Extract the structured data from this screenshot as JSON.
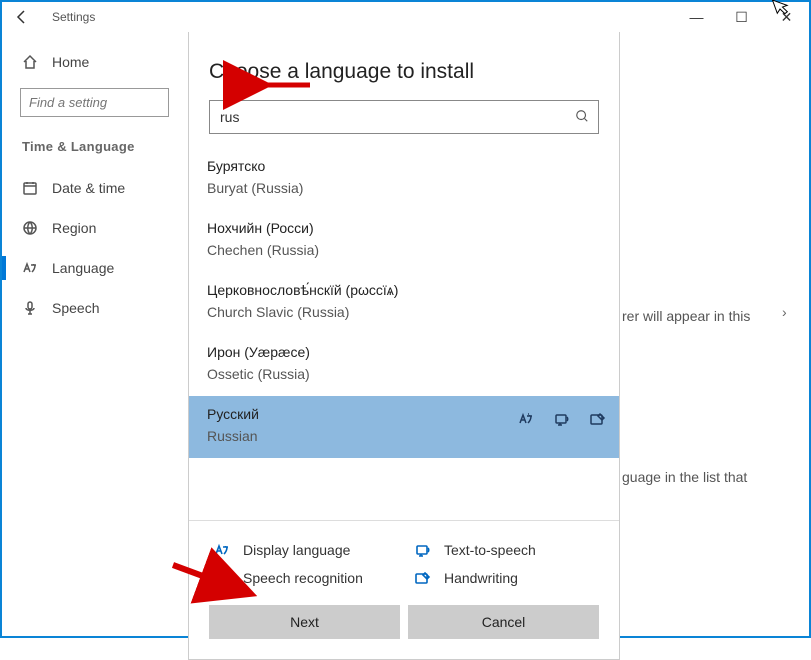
{
  "app": {
    "title": "Settings"
  },
  "window_controls": {
    "min": "—",
    "max": "☐",
    "close": "✕"
  },
  "sidebar": {
    "home_label": "Home",
    "search_placeholder": "Find a setting",
    "category": "Time & Language",
    "items": [
      {
        "label": "Date & time"
      },
      {
        "label": "Region"
      },
      {
        "label": "Language"
      },
      {
        "label": "Speech"
      }
    ]
  },
  "background": {
    "line_a": "rer will appear in this",
    "line_c": "guage in the list that"
  },
  "dialog": {
    "title": "Choose a language to install",
    "search_value": "rus",
    "languages": [
      {
        "native": "Бурятско",
        "english": "Buryat (Russia)",
        "selected": false
      },
      {
        "native": "Нохчийн (Росси)",
        "english": "Chechen (Russia)",
        "selected": false
      },
      {
        "native": "Церковнословѣ́нскїй (рωссїѧ)",
        "english": "Church Slavic (Russia)",
        "selected": false
      },
      {
        "native": "Ирон (Уӕрӕсе)",
        "english": "Ossetic (Russia)",
        "selected": false
      },
      {
        "native": "Русский",
        "english": "Russian",
        "selected": true
      }
    ],
    "features": [
      {
        "label": "Display language"
      },
      {
        "label": "Text-to-speech"
      },
      {
        "label": "Speech recognition"
      },
      {
        "label": "Handwriting"
      }
    ],
    "next_label": "Next",
    "cancel_label": "Cancel"
  }
}
